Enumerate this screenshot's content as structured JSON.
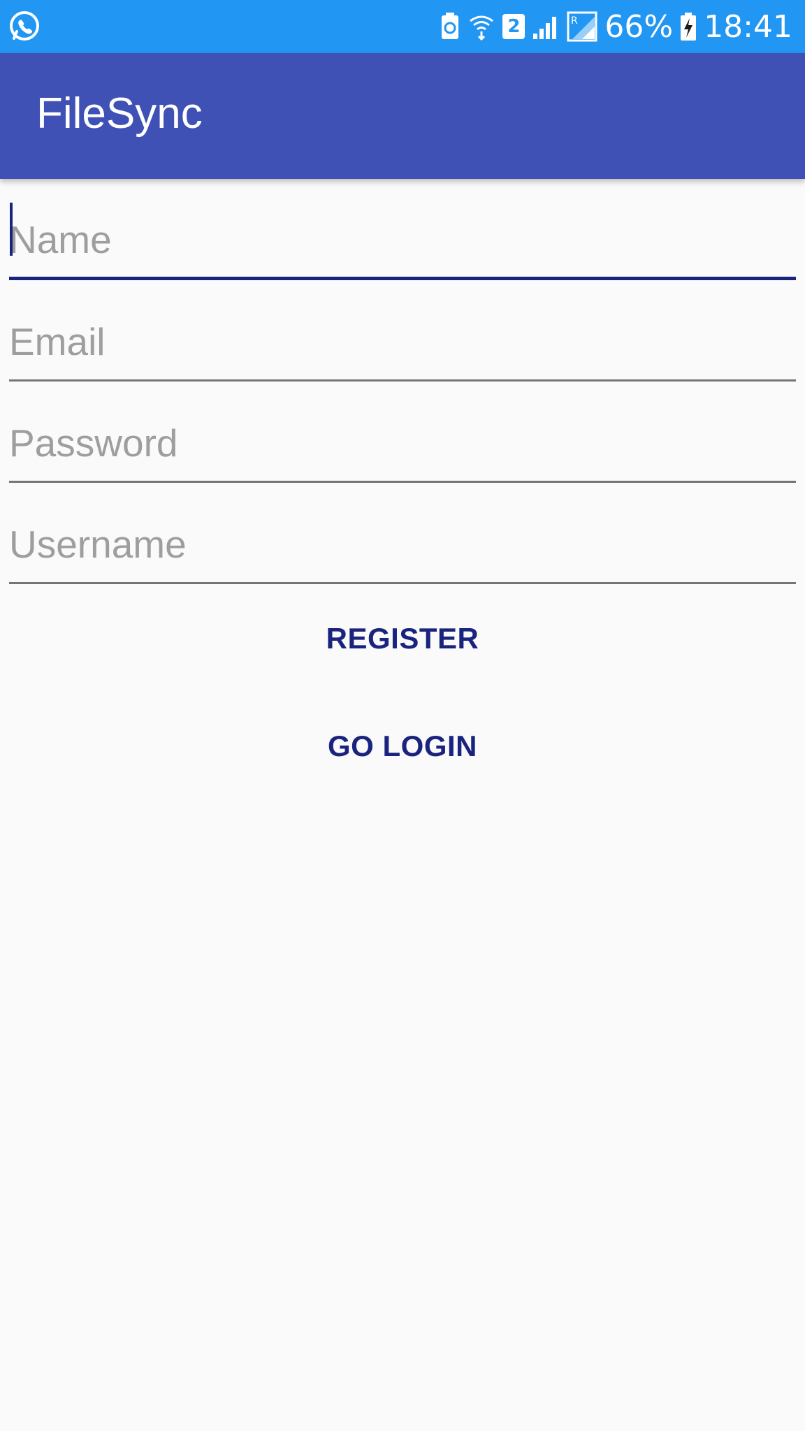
{
  "status_bar": {
    "battery_percent": "66%",
    "time": "18:41",
    "sim_slot": "2",
    "icons": [
      "whatsapp-icon",
      "battery-saver-icon",
      "wifi-icon",
      "sim-2-icon",
      "signal-icon",
      "roaming-signal-icon",
      "charging-battery-icon"
    ]
  },
  "app_bar": {
    "title": "FileSync"
  },
  "form": {
    "name_placeholder": "Name",
    "email_placeholder": "Email",
    "password_placeholder": "Password",
    "username_placeholder": "Username"
  },
  "actions": {
    "register_label": "REGISTER",
    "go_login_label": "GO LOGIN"
  },
  "colors": {
    "status_bar": "#2196f3",
    "app_bar": "#3f51b5",
    "accent": "#1a237e",
    "background": "#fafafa",
    "hint_text": "#9e9e9e"
  }
}
